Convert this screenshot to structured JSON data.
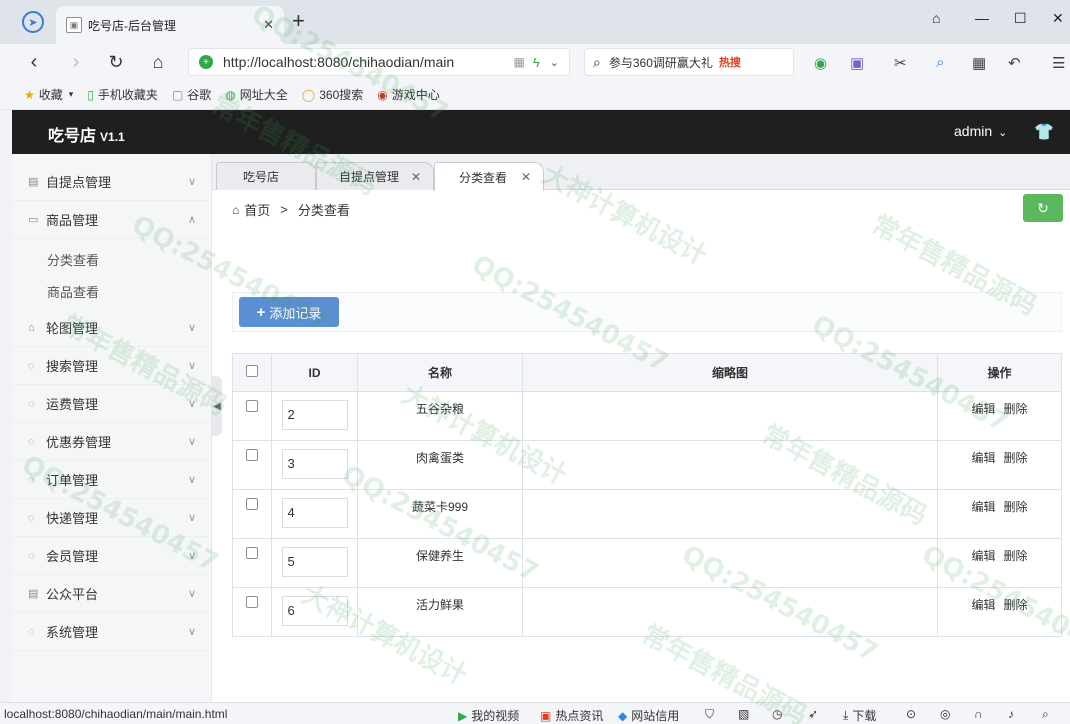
{
  "browser": {
    "tab_title": "吃号店-后台管理",
    "new_tab": "+",
    "url": "http://localhost:8080/chihaodian/main",
    "search_text": "参与360调研赢大礼",
    "search_hot": "热搜",
    "bookmarks": [
      {
        "icon": "star-icon",
        "label": "收藏"
      },
      {
        "icon": "phone-icon",
        "label": "手机收藏夹"
      },
      {
        "icon": "doc-icon",
        "label": "谷歌"
      },
      {
        "icon": "globe-icon",
        "label": "网址大全"
      },
      {
        "icon": "search-icon",
        "label": "360搜索"
      },
      {
        "icon": "game-icon",
        "label": "游戏中心"
      }
    ]
  },
  "app": {
    "title": "吃号店",
    "version": "V1.1",
    "user": "admin"
  },
  "sidebar": {
    "items": [
      {
        "label": "自提点管理",
        "icon": "list-icon",
        "expanded": false
      },
      {
        "label": "商品管理",
        "icon": "image-icon",
        "expanded": true,
        "children": [
          "分类查看",
          "商品查看"
        ]
      },
      {
        "label": "轮图管理",
        "icon": "bag-icon",
        "expanded": false
      },
      {
        "label": "搜索管理",
        "icon": "chat-icon",
        "expanded": false
      },
      {
        "label": "运费管理",
        "icon": "chat-icon",
        "expanded": false
      },
      {
        "label": "优惠券管理",
        "icon": "chat-icon",
        "expanded": false
      },
      {
        "label": "订单管理",
        "icon": "chat-icon",
        "expanded": false
      },
      {
        "label": "快递管理",
        "icon": "chat-icon",
        "expanded": false
      },
      {
        "label": "会员管理",
        "icon": "chat-icon",
        "expanded": false
      },
      {
        "label": "公众平台",
        "icon": "list-icon",
        "expanded": false
      },
      {
        "label": "系统管理",
        "icon": "chat-icon",
        "expanded": false
      }
    ]
  },
  "page_tabs": [
    {
      "label": "吃号店",
      "closable": false,
      "active": false
    },
    {
      "label": "自提点管理",
      "closable": true,
      "active": false
    },
    {
      "label": "分类查看",
      "closable": true,
      "active": true
    }
  ],
  "breadcrumb": {
    "home": "首页",
    "sep": ">",
    "current": "分类查看"
  },
  "toolbar": {
    "add_label": "添加记录"
  },
  "table": {
    "headers": [
      "ID",
      "名称",
      "缩略图",
      "操作"
    ],
    "rows": [
      {
        "id": "2",
        "name": "五谷杂粮"
      },
      {
        "id": "3",
        "name": "肉禽蛋类"
      },
      {
        "id": "4",
        "name": "蔬菜卡999"
      },
      {
        "id": "5",
        "name": "保健养生"
      },
      {
        "id": "6",
        "name": "活力鲜果"
      }
    ],
    "edit_label": "编辑",
    "delete_label": "删除"
  },
  "statusbar": {
    "url": "localhost:8080/chihaodian/main/main.html",
    "items": [
      "我的视频",
      "热点资讯",
      "网站信用",
      "下载"
    ]
  },
  "watermark": [
    "QQ:254540457",
    "常年售精品源码",
    "大神计算机设计"
  ]
}
